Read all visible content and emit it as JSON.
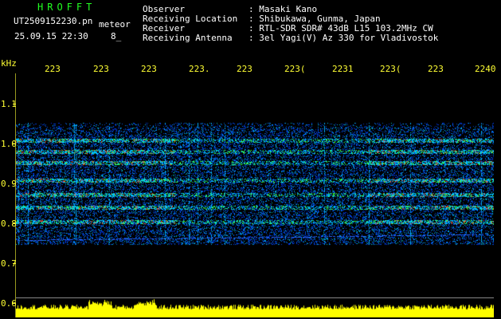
{
  "header": {
    "brand": "HROFFT",
    "filename": "UT2509152230.pn",
    "mode": "meteor",
    "date_time": "25.09.15 22:30",
    "count": "8_",
    "info_labels": [
      "Observer",
      "Receiving Location",
      "Receiver",
      "Receiving Antenna"
    ],
    "info_values": [
      ": Masaki Kano",
      ": Shibukawa, Gunma, Japan",
      ": RTL-SDR SDR# 43dB L15 103.2MHz CW",
      ": 3el Yagi(V) Az 330 for Vladivostok"
    ]
  },
  "axis": {
    "unit": "kHz",
    "x_ticks": [
      "223",
      "223",
      "223",
      "223.",
      "223",
      "223(",
      "2231",
      "223(",
      "223",
      "2240"
    ],
    "y_ticks": [
      "1.1",
      "1.0",
      "0.9",
      "0.8",
      "0.7",
      "0.6"
    ]
  },
  "colors": {
    "background": "#000000",
    "label_yellow": "#ffff33",
    "brand_green": "#22ff22",
    "noise_blue": "#1e5aff"
  }
}
